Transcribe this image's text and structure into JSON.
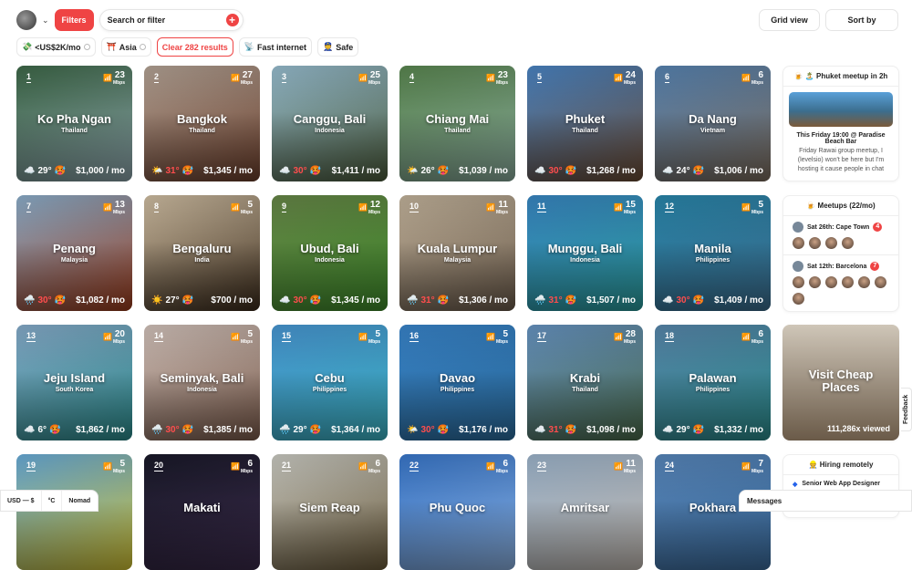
{
  "header": {
    "filters_label": "Filters",
    "search_placeholder": "Search or filter",
    "grid_view_label": "Grid view",
    "sort_label": "Sort by"
  },
  "chips": [
    {
      "icon": "💸",
      "label": "<US$2K/mo"
    },
    {
      "icon": "⛩️",
      "label": "Asia"
    },
    {
      "label": "Clear 282 results"
    },
    {
      "icon": "📡",
      "label": "Fast internet"
    },
    {
      "icon": "👮",
      "label": "Safe"
    }
  ],
  "cities": [
    {
      "rank": "1",
      "name": "Ko Pha Ngan",
      "country": "Thailand",
      "mbps": "23",
      "weather": "☁️",
      "temp": "29°",
      "price": "$1,000 / mo",
      "bg": "#3f6b4a,#8aa1a8"
    },
    {
      "rank": "2",
      "name": "Bangkok",
      "country": "Thailand",
      "mbps": "27",
      "weather": "🌤️",
      "temp": "31°",
      "price": "$1,345 / mo",
      "bg": "#b9a89a,#6a3d2a"
    },
    {
      "rank": "3",
      "name": "Canggu, Bali",
      "country": "Indonesia",
      "mbps": "25",
      "weather": "☁️",
      "temp": "30°",
      "price": "$1,411 / mo",
      "bg": "#9cc3d6,#4a5a3a"
    },
    {
      "rank": "4",
      "name": "Chiang Mai",
      "country": "Thailand",
      "mbps": "23",
      "weather": "🌤️",
      "temp": "26°",
      "price": "$1,039 / mo",
      "bg": "#5c8a52,#88a99a"
    },
    {
      "rank": "5",
      "name": "Phuket",
      "country": "Thailand",
      "mbps": "24",
      "weather": "☁️",
      "temp": "30°",
      "price": "$1,268 / mo",
      "bg": "#4c88c9,#6a4a32"
    },
    {
      "rank": "6",
      "name": "Da Nang",
      "country": "Vietnam",
      "mbps": "6",
      "weather": "☁️",
      "temp": "24°",
      "price": "$1,006 / mo",
      "bg": "#5a88b8,#7a6a5a"
    },
    {
      "rank": "7",
      "name": "Penang",
      "country": "Malaysia",
      "mbps": "13",
      "weather": "🌧️",
      "temp": "30°",
      "price": "$1,082 / mo",
      "bg": "#8fb3d1,#9a3a1a"
    },
    {
      "rank": "8",
      "name": "Bengaluru",
      "country": "India",
      "mbps": "5",
      "weather": "☀️",
      "temp": "27°",
      "price": "$700 / mo",
      "bg": "#d6c4a8,#3a2a1a"
    },
    {
      "rank": "9",
      "name": "Ubud, Bali",
      "country": "Indonesia",
      "mbps": "12",
      "weather": "☁️",
      "temp": "30°",
      "price": "$1,345 / mo",
      "bg": "#6a8a4a,#3e8a2a"
    },
    {
      "rank": "10",
      "name": "Kuala Lumpur",
      "country": "Malaysia",
      "mbps": "11",
      "weather": "🌧️",
      "temp": "31°",
      "price": "$1,306 / mo",
      "bg": "#c8b8a0,#6a5a4a"
    },
    {
      "rank": "11",
      "name": "Munggu, Bali",
      "country": "Indonesia",
      "mbps": "15",
      "weather": "🌧️",
      "temp": "31°",
      "price": "$1,507 / mo",
      "bg": "#3a8ac8,#2a9a9a"
    },
    {
      "rank": "12",
      "name": "Manila",
      "country": "Philippines",
      "mbps": "5",
      "weather": "☁️",
      "temp": "30°",
      "price": "$1,409 / mo",
      "bg": "#2a8ab0,#3a6a8a"
    },
    {
      "rank": "13",
      "name": "Jeju Island",
      "country": "South Korea",
      "mbps": "20",
      "weather": "☁️",
      "temp": "6°",
      "price": "$1,862 / mo",
      "bg": "#8ab0d0,#2a8a8a"
    },
    {
      "rank": "14",
      "name": "Seminyak, Bali",
      "country": "Indonesia",
      "mbps": "5",
      "weather": "🌧️",
      "temp": "30°",
      "price": "$1,385 / mo",
      "bg": "#d8c8c0,#7a5a4a"
    },
    {
      "rank": "15",
      "name": "Cebu",
      "country": "Philippines",
      "mbps": "5",
      "weather": "🌧️",
      "temp": "29°",
      "price": "$1,364 / mo",
      "bg": "#4a9ad8,#3ab0c0"
    },
    {
      "rank": "16",
      "name": "Davao",
      "country": "Philippines",
      "mbps": "5",
      "weather": "🌤️",
      "temp": "30°",
      "price": "$1,176 / mo",
      "bg": "#3a88d0,#2a6a9a"
    },
    {
      "rank": "17",
      "name": "Krabi",
      "country": "Thailand",
      "mbps": "28",
      "weather": "☁️",
      "temp": "31°",
      "price": "$1,098 / mo",
      "bg": "#6a98c8,#4a6a4a"
    },
    {
      "rank": "18",
      "name": "Palawan",
      "country": "Philippines",
      "mbps": "6",
      "weather": "☁️",
      "temp": "29°",
      "price": "$1,332 / mo",
      "bg": "#5a8ab0,#2a8a8a"
    },
    {
      "rank": "19",
      "name": "",
      "country": "",
      "mbps": "5",
      "bg": "#6ab0e0,#d0c030"
    },
    {
      "rank": "20",
      "name": "Makati",
      "country": "",
      "mbps": "6",
      "bg": "#1a1a2a,#3a2a4a"
    },
    {
      "rank": "21",
      "name": "Siem Reap",
      "country": "",
      "mbps": "6",
      "bg": "#d0d0c8,#6a5a3a"
    },
    {
      "rank": "22",
      "name": "Phu Quoc",
      "country": "",
      "mbps": "6",
      "bg": "#3a7ad0,#8ab0e0"
    },
    {
      "rank": "23",
      "name": "Amritsar",
      "country": "",
      "mbps": "11",
      "bg": "#a0b8d0,#c0b8b0"
    },
    {
      "rank": "24",
      "name": "Pokhara",
      "country": "",
      "mbps": "7",
      "bg": "#5a8ac0,#3a6a9a"
    }
  ],
  "mbps_unit": "Mbps",
  "sidebar": {
    "meetup": {
      "title": "🍺 🏝️ Phuket meetup in 2h",
      "event_title": "This Friday 19:00 @ Paradise Beach Bar",
      "event_desc": "Friday Rawai group meetup, I (levelsio) won't be here but I'm hosting it cause people in chat"
    },
    "meetups": {
      "title": "🍺 Meetups (22/mo)",
      "items": [
        {
          "label": "Sat 26th: Cape Town",
          "count": "4",
          "faces": 4
        },
        {
          "label": "Sat 12th: Barcelona",
          "count": "7",
          "faces": 7
        }
      ]
    },
    "promo": {
      "title": "Visit Cheap Places",
      "views": "111,286x viewed"
    },
    "hiring": {
      "title": "👷 Hiring remotely",
      "job": "Senior Web App Designer"
    }
  },
  "footer": {
    "currency": "USD — $",
    "units": "°C",
    "mode": "Nomad"
  },
  "feedback_label": "Feedback",
  "messages_label": "Messages"
}
